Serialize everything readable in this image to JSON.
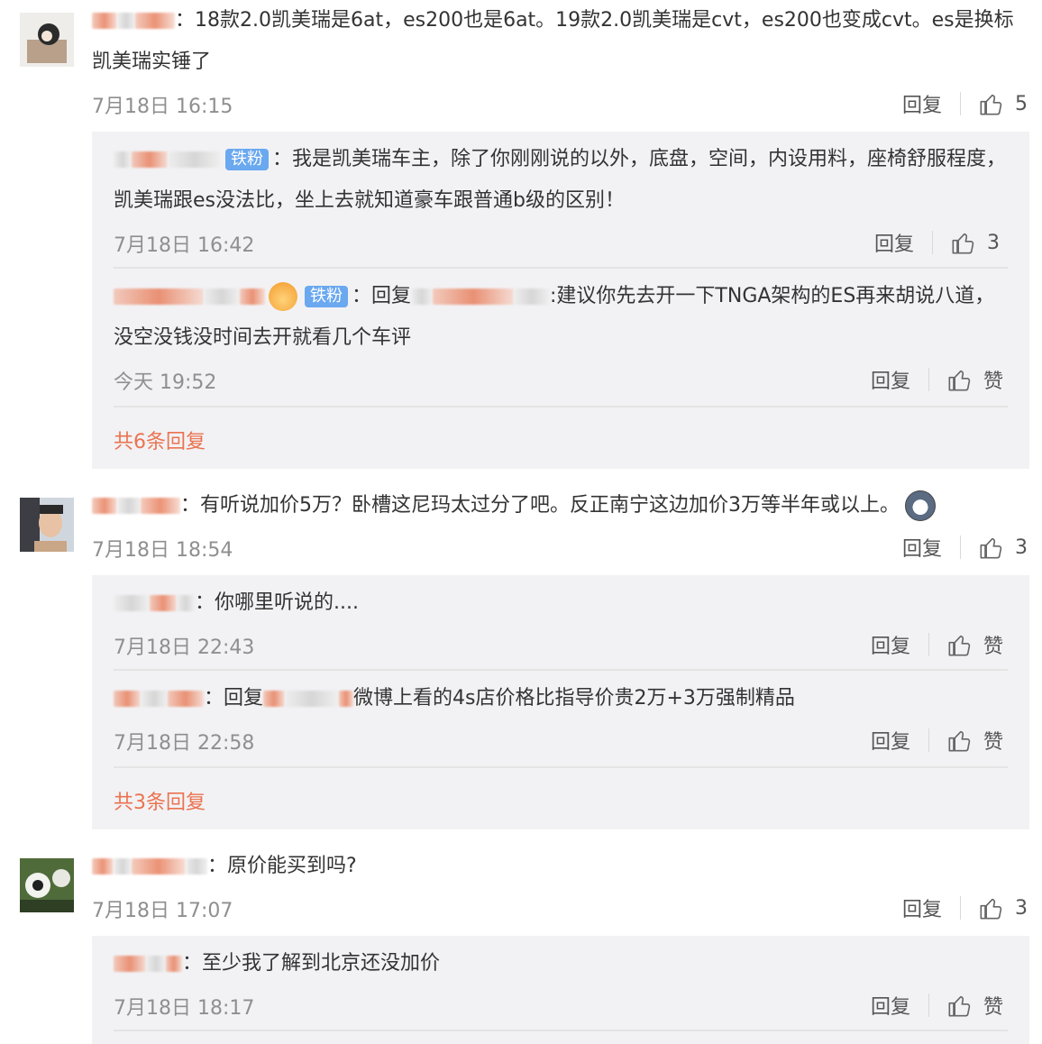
{
  "actions": {
    "reply": "回复",
    "like": "赞"
  },
  "badge": "铁粉",
  "comments": [
    {
      "user": "黄…",
      "text": "：18款2.0凯美瑞是6at，es200也是6at。19款2.0凯美瑞是cvt，es200也变成cvt。es是换标凯美瑞实锤了",
      "time": "7月18日 16:15",
      "likes": "5",
      "replies": [
        {
          "user": "…",
          "text": "：我是凯美瑞车主，除了你刚刚说的以外，底盘，空间，内设用料，座椅舒服程度，凯美瑞跟es没法比，坐上去就知道豪车跟普通b级的区别！",
          "time": "7月18日 16:42",
          "likes": "3"
        },
        {
          "user": "38号…",
          "reply_prefix": "：回复",
          "reply_target": "@…",
          "text": ":建议你先去开一下TNGA架构的ES再来胡说八道，没空没钱没时间去开就看几个车评",
          "time": "今天 19:52",
          "likes": "赞"
        }
      ],
      "more": "共6条回复"
    },
    {
      "user": "京…",
      "text": "：有听说加价5万？卧槽这尼玛太过分了吧。反正南宁这边加价3万等半年或以上。",
      "time": "7月18日 18:54",
      "likes": "3",
      "replies": [
        {
          "user": "…",
          "text": "：你哪里听说的....",
          "time": "7月18日 22:43",
          "likes": "赞"
        },
        {
          "user": "京…",
          "reply_prefix": "：回复",
          "reply_target": "@…",
          "text": "微博上看的4s店价格比指导价贵2万+3万强制精品",
          "time": "7月18日 22:58",
          "likes": "赞"
        }
      ],
      "more": "共3条回复"
    },
    {
      "user": "阿…t",
      "text": "：原价能买到吗?",
      "time": "7月18日 17:07",
      "likes": "3",
      "replies": [
        {
          "user": "…z",
          "text": "：至少我了解到北京还没加价",
          "time": "7月18日 18:17",
          "likes": "赞"
        }
      ]
    }
  ]
}
